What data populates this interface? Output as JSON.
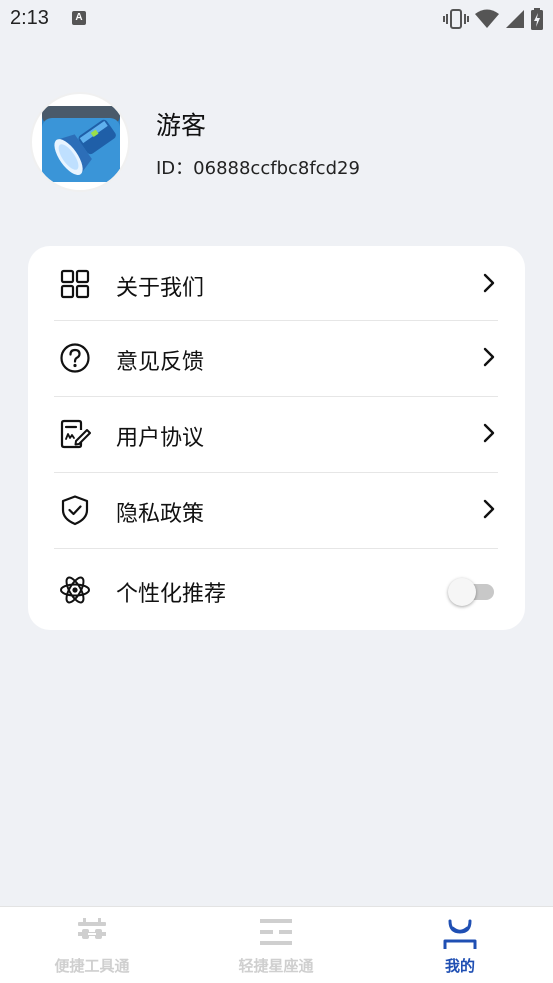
{
  "status_bar": {
    "time": "2:13",
    "notification_letter": "A",
    "icons": [
      "vibrate-icon",
      "wifi-icon",
      "signal-icon",
      "battery-charging-icon"
    ]
  },
  "profile": {
    "name": "游客",
    "id_label": "ID：",
    "id_value": "06888ccfbc8fcd29",
    "avatar_icon": "flashlight-app-icon"
  },
  "menu": {
    "items": [
      {
        "label": "关于我们",
        "icon": "grid-icon"
      },
      {
        "label": "意见反馈",
        "icon": "question-circle-icon"
      },
      {
        "label": "用户协议",
        "icon": "document-edit-icon"
      },
      {
        "label": "隐私政策",
        "icon": "shield-check-icon"
      },
      {
        "label": "个性化推荐",
        "icon": "atom-icon"
      }
    ],
    "recommend_enabled": false
  },
  "bottom_nav": {
    "items": [
      {
        "label": "便捷工具通",
        "icon": "tools-icon",
        "active": false
      },
      {
        "label": "轻捷星座通",
        "icon": "lines-icon",
        "active": false
      },
      {
        "label": "我的",
        "icon": "profile-icon",
        "active": true
      }
    ],
    "active_color": "#1f4fb3",
    "inactive_color": "#cfcfcf"
  }
}
